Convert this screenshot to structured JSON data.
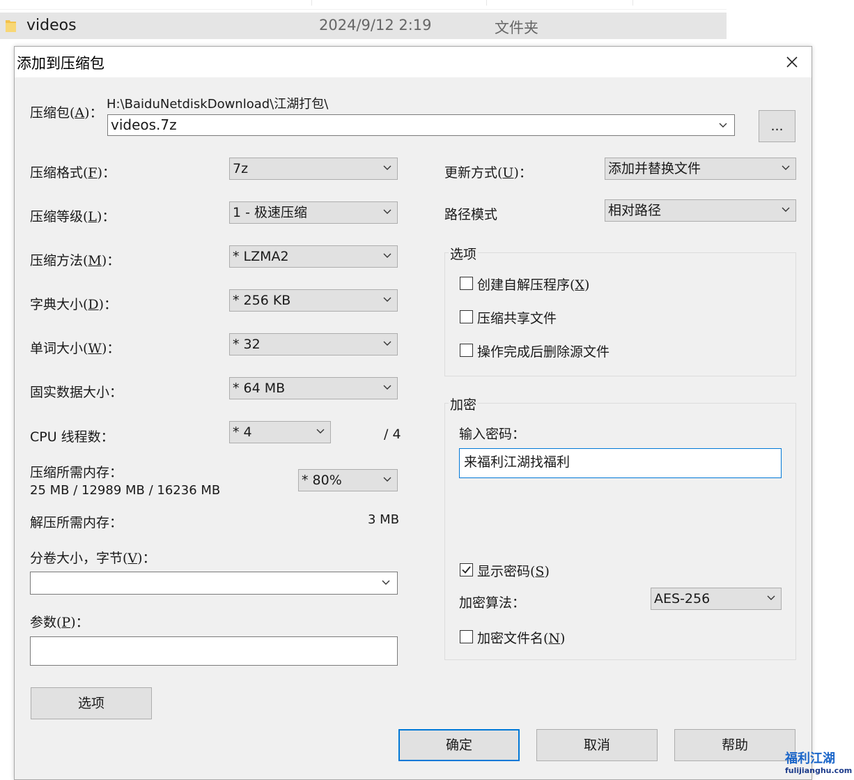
{
  "explorer": {
    "folder_name": "videos",
    "date_modified": "2024/9/12 2:19",
    "type": "文件夹"
  },
  "dialog": {
    "title": "添加到压缩包",
    "close_glyph": "✕",
    "archive": {
      "label": "压缩包(A)：",
      "label_pre": "压缩包(",
      "label_key": "A",
      "label_post": ")：",
      "path": "H:\\BaiduNetdiskDownload\\江湖打包\\",
      "filename": "videos.7z",
      "browse_label": "..."
    },
    "left": {
      "format": {
        "pre": "压缩格式(",
        "key": "F",
        "post": ")：",
        "value": "7z"
      },
      "level": {
        "pre": "压缩等级(",
        "key": "L",
        "post": ")：",
        "value": "1 - 极速压缩"
      },
      "method": {
        "pre": "压缩方法(",
        "key": "M",
        "post": ")：",
        "value": "*  LZMA2"
      },
      "dict": {
        "pre": "字典大小(",
        "key": "D",
        "post": ")：",
        "value": "*  256 KB"
      },
      "word": {
        "pre": "单词大小(",
        "key": "W",
        "post": ")：",
        "value": "*  32"
      },
      "solid": {
        "label": "固实数据大小：",
        "value": "*  64 MB"
      },
      "threads": {
        "label": "CPU 线程数：",
        "value": "*  4",
        "max": "/ 4"
      },
      "mem_compress": {
        "label": "压缩所需内存：",
        "value": "25 MB / 12989 MB / 16236 MB",
        "percent": "*  80%"
      },
      "mem_decompress": {
        "label": "解压所需内存：",
        "value": "3 MB"
      },
      "volume": {
        "pre": "分卷大小，字节(",
        "key": "V",
        "post": ")：",
        "value": ""
      },
      "params": {
        "pre": "参数(",
        "key": "P",
        "post": ")：",
        "value": ""
      },
      "options_button": "选项"
    },
    "right": {
      "update_mode": {
        "pre": "更新方式(",
        "key": "U",
        "post": ")：",
        "value": "添加并替换文件"
      },
      "path_mode": {
        "label": "路径模式",
        "value": "相对路径"
      },
      "options_group": {
        "title": "选项",
        "sfx": {
          "pre": "创建自解压程序(",
          "key": "X",
          "post": ")",
          "checked": false
        },
        "shared": {
          "label": "压缩共享文件",
          "checked": false
        },
        "delete": {
          "label": "操作完成后删除源文件",
          "checked": false
        }
      },
      "encryption": {
        "title": "加密",
        "password_label": "输入密码：",
        "password_value": "来福利江湖找福利",
        "show_password": {
          "pre": "显示密码(",
          "key": "S",
          "post": ")",
          "checked": true
        },
        "method_label": "加密算法：",
        "method_value": "AES-256",
        "encrypt_names": {
          "pre": "加密文件名(",
          "key": "N",
          "post": ")",
          "checked": false
        }
      }
    },
    "buttons": {
      "ok": "确定",
      "cancel": "取消",
      "help": "帮助"
    }
  },
  "watermark": {
    "text": "福利江湖",
    "url": "fulijianghu.com"
  },
  "colors": {
    "dialog_bg": "#f0f0f0",
    "accent": "#0078d7",
    "watermark": "#1b66c9"
  }
}
